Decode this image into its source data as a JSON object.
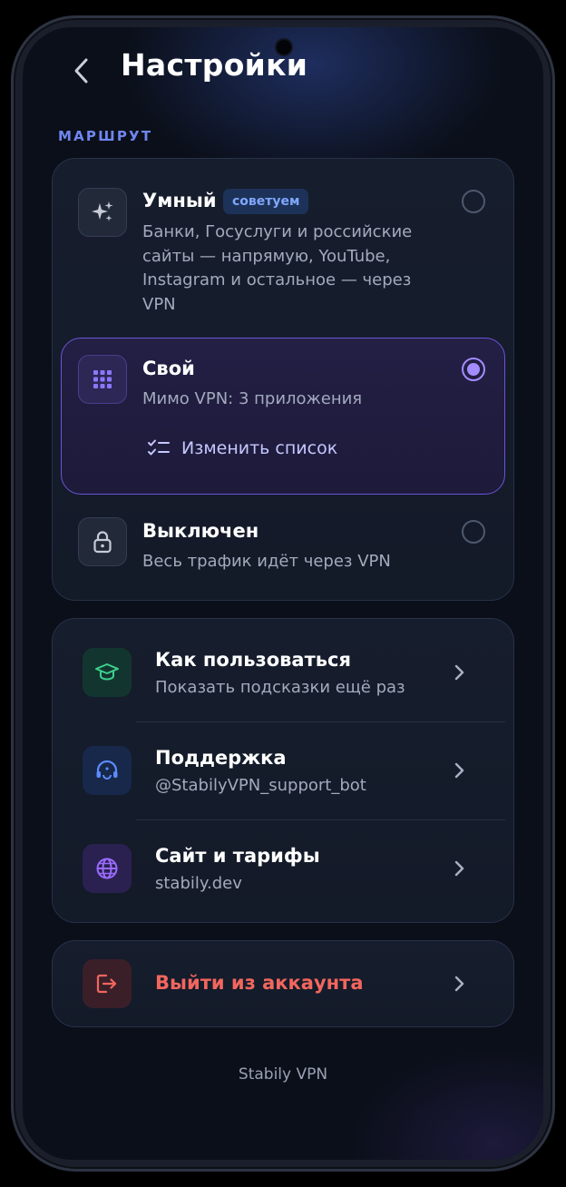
{
  "header": {
    "title": "Настройки"
  },
  "route": {
    "section_label": "МАРШРУТ",
    "options": [
      {
        "title": "Умный",
        "badge": "советуем",
        "desc_lines": [
          "Банки, Госуслуги и российские",
          "сайты — напрямую, YouTube,",
          "Instagram и остальное — через",
          "VPN"
        ],
        "selected": false,
        "icon": "sparkles-icon"
      },
      {
        "title": "Свой",
        "desc": "Мимо VPN: 3 приложения",
        "edit_label": "Изменить список",
        "selected": true,
        "icon": "apps-grid-icon"
      },
      {
        "title": "Выключен",
        "desc": "Весь трафик идёт через VPN",
        "selected": false,
        "icon": "lock-icon"
      }
    ]
  },
  "menu": {
    "items": [
      {
        "title": "Как пользоваться",
        "sub": "Показать подсказки ещё раз",
        "icon": "graduation-cap-icon",
        "color": "#3ecf8e"
      },
      {
        "title": "Поддержка",
        "sub": "@StabilyVPN_support_bot",
        "icon": "headset-icon",
        "color": "#5b8cff"
      },
      {
        "title": "Сайт и тарифы",
        "sub": "stabily.dev",
        "icon": "globe-icon",
        "color": "#9a6bff"
      }
    ]
  },
  "logout": {
    "label": "Выйти из аккаунта",
    "icon": "logout-icon",
    "color": "#f2665e"
  },
  "footer": {
    "text": "Stabily VPN"
  },
  "colors": {
    "accent": "#a38cff",
    "section": "#6f86f0",
    "danger": "#f2665e"
  }
}
